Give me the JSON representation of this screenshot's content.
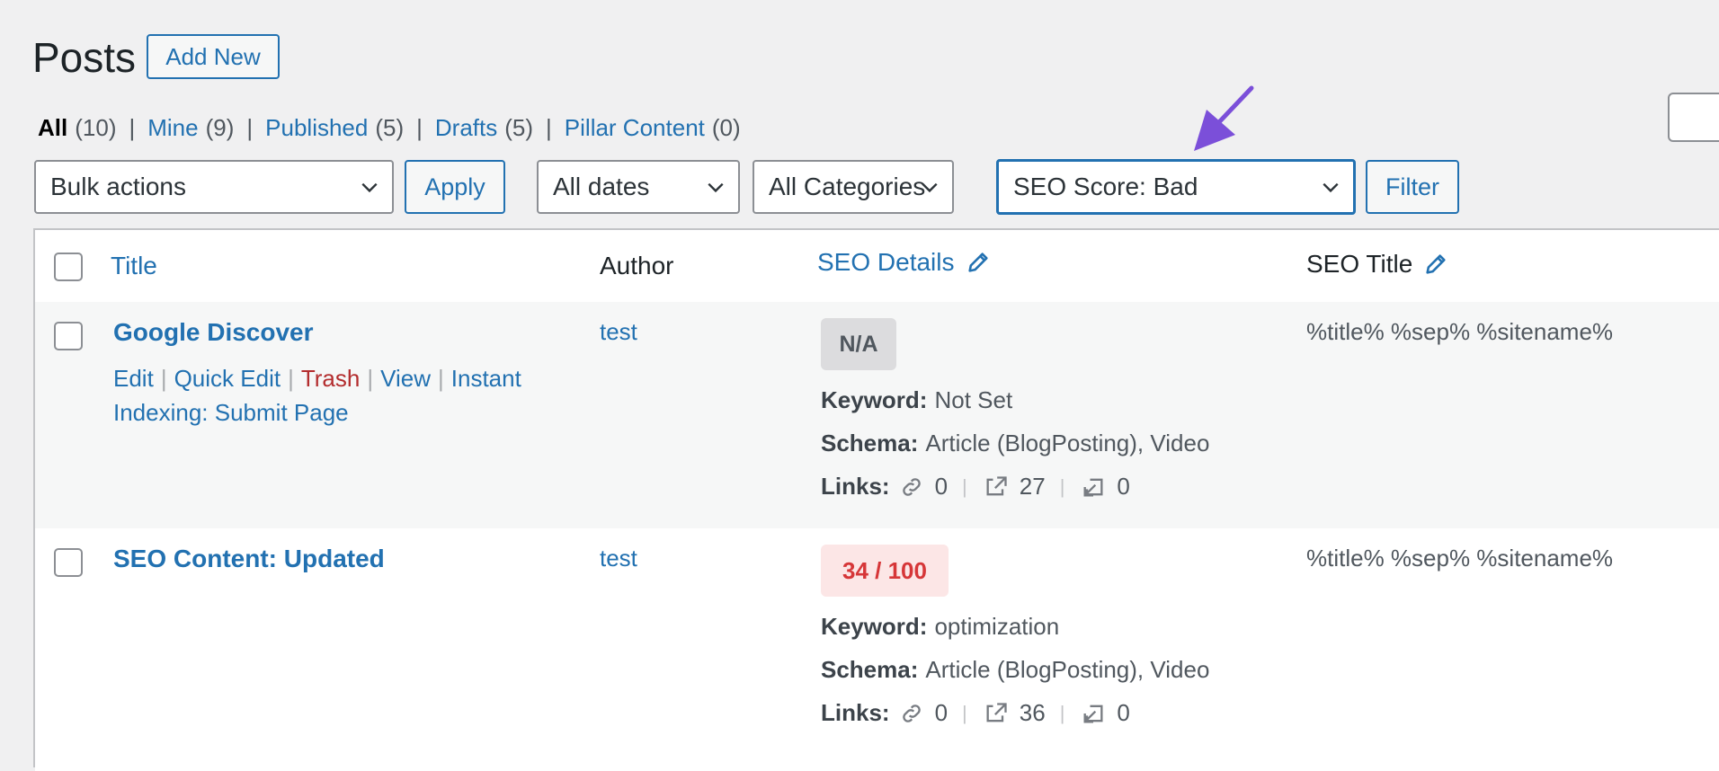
{
  "header": {
    "title": "Posts",
    "add_new": "Add New"
  },
  "views": [
    {
      "label": "All",
      "count": "(10)",
      "current": true
    },
    {
      "label": "Mine",
      "count": "(9)"
    },
    {
      "label": "Published",
      "count": "(5)"
    },
    {
      "label": "Drafts",
      "count": "(5)"
    },
    {
      "label": "Pillar Content",
      "count": "(0)"
    }
  ],
  "filters": {
    "bulk_actions": "Bulk actions",
    "apply": "Apply",
    "dates": "All dates",
    "categories": "All Categories",
    "seo_score": "SEO Score: Bad",
    "filter": "Filter"
  },
  "table": {
    "columns": {
      "title": "Title",
      "author": "Author",
      "seo_details": "SEO Details",
      "seo_title": "SEO Title"
    },
    "rows": [
      {
        "title": "Google Discover",
        "actions": {
          "edit": "Edit",
          "quick_edit": "Quick Edit",
          "trash": "Trash",
          "view": "View",
          "instant": "Instant",
          "indexing": "Indexing: Submit Page"
        },
        "author": "test",
        "score": "N/A",
        "keyword_label": "Keyword:",
        "keyword": "Not Set",
        "schema_label": "Schema:",
        "schema": "Article (BlogPosting), Video",
        "links_label": "Links:",
        "internal": "0",
        "external": "27",
        "incoming": "0",
        "seo_title": "%title% %sep% %sitename%"
      },
      {
        "title": "SEO Content: Updated",
        "author": "test",
        "score": "34 / 100",
        "keyword_label": "Keyword:",
        "keyword": "optimization",
        "schema_label": "Schema:",
        "schema": "Article (BlogPosting), Video",
        "links_label": "Links:",
        "internal": "0",
        "external": "36",
        "incoming": "0",
        "seo_title": "%title% %sep% %sitename%"
      }
    ]
  },
  "icons": {
    "chevron": "chevron-down-icon",
    "edit": "pencil-icon",
    "internal_link": "link-icon",
    "external_link": "external-link-icon",
    "incoming_link": "incoming-link-icon",
    "annotation": "arrow-annotation-icon"
  },
  "colors": {
    "link": "#2271b1",
    "trash": "#b32d2e",
    "bad_score": "#d63638",
    "annotation": "#7b4fd9"
  }
}
